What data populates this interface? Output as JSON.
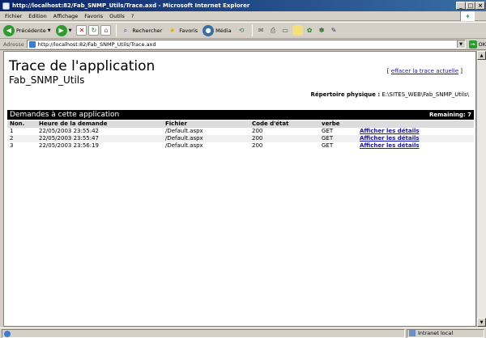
{
  "window": {
    "title": "http://localhost:82/Fab_SNMP_Utils/Trace.axd - Microsoft Internet Explorer"
  },
  "menu": [
    "Fichier",
    "Edition",
    "Affichage",
    "Favoris",
    "Outils",
    "?"
  ],
  "toolbar": {
    "back_label": "Précédente",
    "search_label": "Rechercher",
    "favorites_label": "Favoris",
    "media_label": "Média"
  },
  "address": {
    "label": "Adresse",
    "url": "http://localhost:82/Fab_SNMP_Utils/Trace.axd",
    "go_label": "OK"
  },
  "page": {
    "title": "Trace de l'application",
    "subtitle": "Fab_SNMP_Utils",
    "clear_open": "[",
    "clear_link": "effacer la trace actuelle",
    "clear_close": "]",
    "phys_label": "Répertoire physique :",
    "phys_path": "E:\\SITES_WEB\\Fab_SNMP_Utils\\"
  },
  "requests": {
    "title": "Demandes à cette application",
    "remaining": "Remaining: 7",
    "headers": [
      "Non.",
      "Heure de la demande",
      "Fichier",
      "Code d'état",
      "verbe",
      ""
    ],
    "rows": [
      {
        "num": "1",
        "time": "22/05/2003 23:55:42",
        "file": "/Default.aspx",
        "code": "200",
        "verb": "GET",
        "link": "Afficher les détails"
      },
      {
        "num": "2",
        "time": "22/05/2003 23:55:47",
        "file": "/Default.aspx",
        "code": "200",
        "verb": "GET",
        "link": "Afficher les détails"
      },
      {
        "num": "3",
        "time": "22/05/2003 23:56:19",
        "file": "/Default.aspx",
        "code": "200",
        "verb": "GET",
        "link": "Afficher les détails"
      }
    ]
  },
  "status": {
    "zone": "Intranet local"
  }
}
